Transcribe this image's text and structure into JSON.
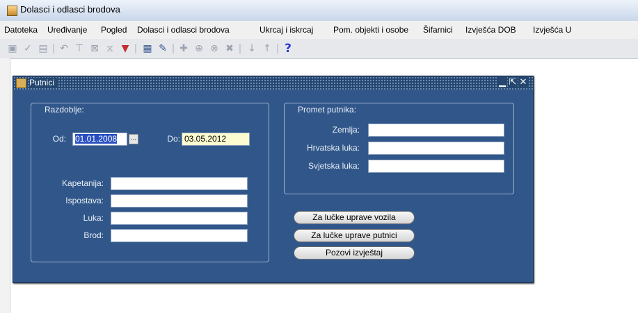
{
  "window": {
    "title": "Dolasci i odlasci brodova"
  },
  "menu": [
    {
      "label": "Datoteka"
    },
    {
      "label": "Uređivanje"
    },
    {
      "label": "Pogled"
    },
    {
      "label": "Dolasci i odlasci brodova"
    },
    {
      "label": "Ukrcaj i iskrcaj"
    },
    {
      "label": "Pom. objekti i osobe"
    },
    {
      "label": "Šifarnici"
    },
    {
      "label": "Izvješća DOB"
    },
    {
      "label": "Izvješća U"
    }
  ],
  "toolbar": {
    "help_glyph": "?"
  },
  "form": {
    "title": "Putnici",
    "razdoblje": {
      "label": "Razdoblje:",
      "od_label": "Od:",
      "od_value": "01.01.2008",
      "lov_glyph": "...",
      "do_label": "Do:",
      "do_value": "03.05.2012"
    },
    "promet": {
      "label": "Promet putnika:",
      "zemlja_label": "Zemlja:",
      "hrvatska_luka_label": "Hrvatska luka:",
      "svjetska_luka_label": "Svjetska luka:"
    },
    "location": {
      "kapetanija_label": "Kapetanija:",
      "ispostava_label": "Ispostava:",
      "luka_label": "Luka:",
      "brod_label": "Brod:"
    },
    "buttons": {
      "vozila": "Za lučke uprave vozila",
      "putnici": "Za lučke uprave putnici",
      "izvjestaj": "Pozovi izvještaj"
    }
  }
}
